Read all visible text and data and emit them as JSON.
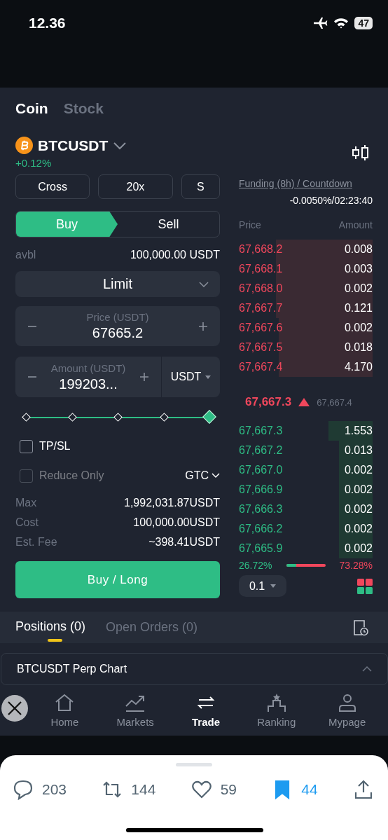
{
  "status_bar": {
    "time": "12.36",
    "battery": "47"
  },
  "market_tabs": [
    {
      "label": "Coin",
      "selected": true
    },
    {
      "label": "Stock",
      "selected": false
    }
  ],
  "pair": {
    "symbol": "BTCUSDT",
    "change": "+0.12%"
  },
  "margin_buttons": [
    "Cross",
    "20x",
    "S"
  ],
  "sides": [
    {
      "label": "Buy",
      "selected": true
    },
    {
      "label": "Sell",
      "selected": false
    }
  ],
  "available": {
    "label": "avbl",
    "value": "100,000.00 USDT"
  },
  "order_type": "Limit",
  "price_field": {
    "label": "Price (USDT)",
    "value": "67665.2"
  },
  "amount_field": {
    "label": "Amount (USDT)",
    "value": "199203...",
    "unit": "USDT"
  },
  "amount_slider": {
    "level": 1
  },
  "options": [
    {
      "label": "TP/SL",
      "checked": false,
      "disabled": false
    },
    {
      "label": "Reduce Only",
      "checked": false,
      "disabled": true
    }
  ],
  "time_in_force": "GTC",
  "summary": [
    {
      "label": "Max",
      "value": "1,992,031.87USDT"
    },
    {
      "label": "Cost",
      "value": "100,000.00USDT"
    },
    {
      "label": "Est. Fee",
      "value": "~398.41USDT"
    }
  ],
  "submit": "Buy / Long",
  "funding": {
    "label": "Funding (8h) / Countdown",
    "value": "-0.0050%/02:23:40"
  },
  "order_book": {
    "columns": [
      "Price",
      "Amount"
    ],
    "asks": [
      {
        "price": "67,668.2",
        "amount": "0.008",
        "level": 0.72
      },
      {
        "price": "67,668.1",
        "amount": "0.003",
        "level": 0.72
      },
      {
        "price": "67,668.0",
        "amount": "0.002",
        "level": 0.72
      },
      {
        "price": "67,667.7",
        "amount": "0.121",
        "level": 0.72
      },
      {
        "price": "67,667.6",
        "amount": "0.002",
        "level": 0.7
      },
      {
        "price": "67,667.5",
        "amount": "0.018",
        "level": 0.7
      },
      {
        "price": "67,667.4",
        "amount": "4.170",
        "level": 0.7
      }
    ],
    "last_price": "67,667.3",
    "mark_price": "67,667.4",
    "bids": [
      {
        "price": "67,667.3",
        "amount": "1.553",
        "level": 0.33
      },
      {
        "price": "67,667.2",
        "amount": "0.013",
        "level": 0.25
      },
      {
        "price": "67,667.0",
        "amount": "0.002",
        "level": 0.25
      },
      {
        "price": "67,666.9",
        "amount": "0.002",
        "level": 0.25
      },
      {
        "price": "67,666.3",
        "amount": "0.002",
        "level": 0.25
      },
      {
        "price": "67,666.2",
        "amount": "0.002",
        "level": 0.25
      },
      {
        "price": "67,665.9",
        "amount": "0.002",
        "level": 0.25
      }
    ],
    "buy_ratio": "26.72%",
    "sell_ratio": "73.28%",
    "level": 0.2672,
    "precision": "0.1"
  },
  "bottom_tabs": [
    {
      "label": "Positions (0)",
      "selected": true
    },
    {
      "label": "Open Orders (0)",
      "selected": false
    }
  ],
  "chart_panel": {
    "title": "BTCUSDT Perp Chart"
  },
  "nav": [
    {
      "kind": "home",
      "label": "Home",
      "selected": false
    },
    {
      "kind": "markets",
      "label": "Markets",
      "selected": false
    },
    {
      "kind": "trade",
      "label": "Trade",
      "selected": true
    },
    {
      "kind": "ranking",
      "label": "Ranking",
      "selected": false
    },
    {
      "kind": "mypage",
      "label": "Mypage",
      "selected": false
    }
  ],
  "post_actions": [
    {
      "kind": "reply",
      "count": "203",
      "selected": false
    },
    {
      "kind": "repost",
      "count": "144",
      "selected": false
    },
    {
      "kind": "like",
      "count": "59",
      "selected": false
    },
    {
      "kind": "bookmark",
      "count": "44",
      "selected": true
    },
    {
      "kind": "share",
      "selected": false
    }
  ]
}
